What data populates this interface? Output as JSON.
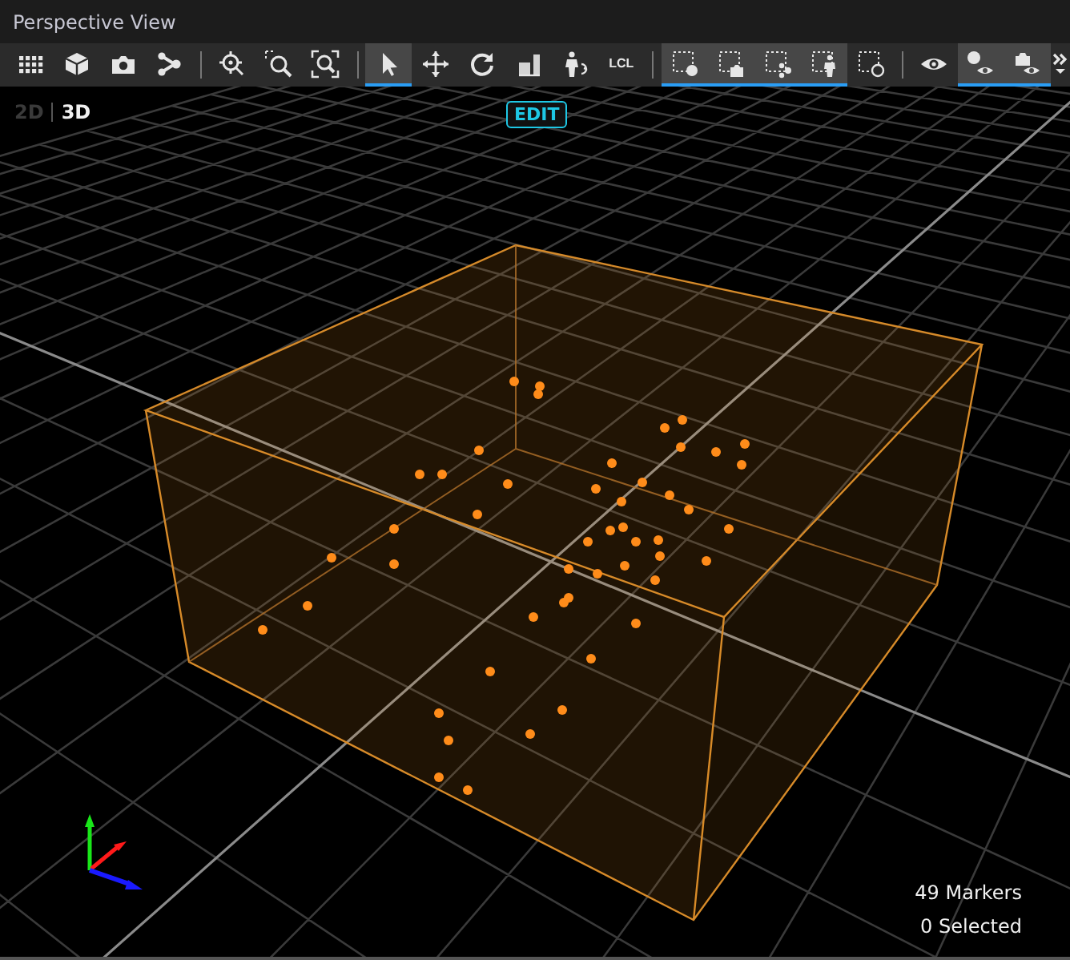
{
  "window": {
    "title": "Perspective View"
  },
  "toolbar": [
    [
      {
        "kind": "grid",
        "selected": false
      },
      {
        "kind": "cube",
        "selected": false
      },
      {
        "kind": "camera",
        "selected": false
      },
      {
        "kind": "nodes",
        "selected": false
      }
    ],
    [
      {
        "kind": "zoom-target",
        "selected": false
      },
      {
        "kind": "zoom-region",
        "selected": false
      },
      {
        "kind": "zoom-fit",
        "selected": false
      }
    ],
    [
      {
        "kind": "pointer",
        "selected": true
      },
      {
        "kind": "move",
        "selected": false
      },
      {
        "kind": "rotate",
        "selected": false
      },
      {
        "kind": "scale",
        "selected": false
      },
      {
        "kind": "skeleton",
        "selected": false
      },
      {
        "kind": "text",
        "label": "LCL",
        "selected": false
      }
    ],
    [
      {
        "kind": "select-marker",
        "selected": true
      },
      {
        "kind": "select-camera",
        "selected": true
      },
      {
        "kind": "select-node",
        "selected": true
      },
      {
        "kind": "select-skeleton",
        "selected": true
      },
      {
        "kind": "select-empty",
        "selected": false
      }
    ],
    [
      {
        "kind": "eye",
        "selected": false
      },
      {
        "kind": "show-markers",
        "selected": true
      },
      {
        "kind": "show-cameras",
        "selected": true
      }
    ]
  ],
  "overflow": {
    "kind": "overflow"
  },
  "view_modes": [
    {
      "label": "2D",
      "selected": false
    },
    {
      "label": "3D",
      "selected": true
    }
  ],
  "edit_badge": "EDIT",
  "status": [
    "49 Markers",
    "0 Selected"
  ]
}
